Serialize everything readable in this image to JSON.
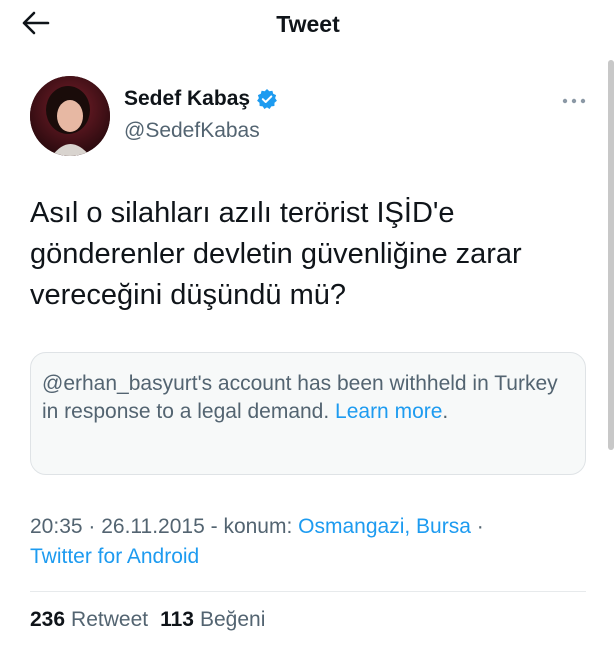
{
  "header": {
    "back_icon": "arrow-left-icon",
    "title": "Tweet"
  },
  "author": {
    "name": "Sedef Kabaş",
    "handle": "@SedefKabas",
    "verified_icon": "verified-badge-icon",
    "more_icon": "more-dots-icon"
  },
  "tweet": {
    "text": "Asıl o silahları azılı terörist IŞİD'e\ngönderenler devletin güvenliğine zarar\nvereceğini düşündü mü?"
  },
  "withheld_notice": {
    "text": "@erhan_basyurt's account has been withheld in Turkey in response to a legal demand. ",
    "link_label": "Learn more",
    "suffix": "."
  },
  "meta": {
    "time": "20:35",
    "date": "26.11.2015",
    "location_prefix": "konum:",
    "location": "Osmangazi, Bursa",
    "source": "Twitter for Android"
  },
  "stats": {
    "retweets_count": "236",
    "retweets_label": "Retweet",
    "likes_count": "113",
    "likes_label": "Beğeni"
  },
  "colors": {
    "accent": "#1d9bf0",
    "secondary_text": "#536471",
    "primary_text": "#0f1419"
  }
}
